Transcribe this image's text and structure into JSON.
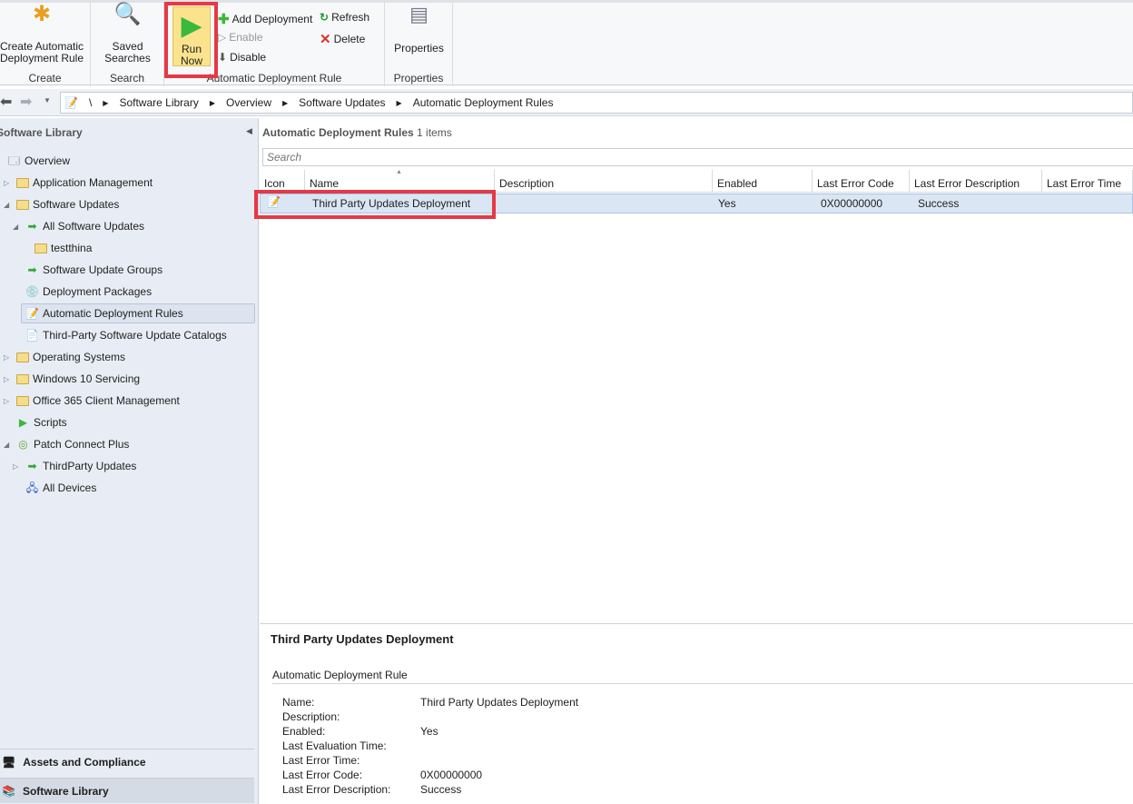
{
  "ribbon": {
    "create": {
      "button": "Create Automatic\nDeployment Rule",
      "label": "Create"
    },
    "search": {
      "button": "Saved\nSearches",
      "label": "Search"
    },
    "adr": {
      "run_now": "Run\nNow",
      "add_deployment": "Add Deployment",
      "enable": "Enable",
      "disable": "Disable",
      "refresh": "Refresh",
      "delete": "Delete",
      "label": "Automatic Deployment Rule"
    },
    "properties": {
      "button": "Properties",
      "label": "Properties"
    }
  },
  "breadcrumb": [
    "\\",
    "Software Library",
    "Overview",
    "Software Updates",
    "Automatic Deployment Rules"
  ],
  "sidebar": {
    "title": "Software Library",
    "items": [
      {
        "label": "Overview",
        "icon": "overview-icon"
      },
      {
        "label": "Application Management",
        "icon": "folder-icon"
      },
      {
        "label": "Software Updates",
        "icon": "folder-icon"
      },
      {
        "label": "All Software Updates",
        "icon": "updates-icon"
      },
      {
        "label": "testthina",
        "icon": "folder-icon"
      },
      {
        "label": "Software Update Groups",
        "icon": "updates-icon"
      },
      {
        "label": "Deployment Packages",
        "icon": "package-icon"
      },
      {
        "label": "Automatic Deployment Rules",
        "icon": "rule-icon"
      },
      {
        "label": "Third-Party Software Update Catalogs",
        "icon": "catalog-icon"
      },
      {
        "label": "Operating Systems",
        "icon": "folder-icon"
      },
      {
        "label": "Windows 10 Servicing",
        "icon": "folder-icon"
      },
      {
        "label": "Office 365 Client Management",
        "icon": "folder-icon"
      },
      {
        "label": "Scripts",
        "icon": "play-icon"
      },
      {
        "label": "Patch Connect Plus",
        "icon": "patch-icon"
      },
      {
        "label": "ThirdParty Updates",
        "icon": "updates-icon"
      },
      {
        "label": "All Devices",
        "icon": "devices-icon"
      }
    ],
    "workspaces": [
      "Assets and Compliance",
      "Software Library"
    ]
  },
  "list": {
    "title": "Automatic Deployment Rules",
    "count": "1 items",
    "search_placeholder": "Search",
    "columns": [
      "Icon",
      "Name",
      "Description",
      "Enabled",
      "Last Error Code",
      "Last Error Description",
      "Last Error Time"
    ],
    "rows": [
      {
        "name": "Third Party Updates Deployment",
        "description": "",
        "enabled": "Yes",
        "error_code": "0X00000000",
        "error_desc": "Success",
        "error_time": ""
      }
    ]
  },
  "detail": {
    "title": "Third Party Updates Deployment",
    "section": "Automatic Deployment Rule",
    "fields": [
      {
        "label": "Name:",
        "value": "Third Party Updates Deployment"
      },
      {
        "label": "Description:",
        "value": ""
      },
      {
        "label": "Enabled:",
        "value": "Yes"
      },
      {
        "label": "Last Evaluation Time:",
        "value": ""
      },
      {
        "label": "Last Error Time:",
        "value": ""
      },
      {
        "label": "Last Error Code:",
        "value": "0X00000000"
      },
      {
        "label": "Last Error Description:",
        "value": "Success"
      }
    ]
  },
  "colors": {
    "highlight": "#e53945",
    "selected": "#dbe6f4"
  }
}
